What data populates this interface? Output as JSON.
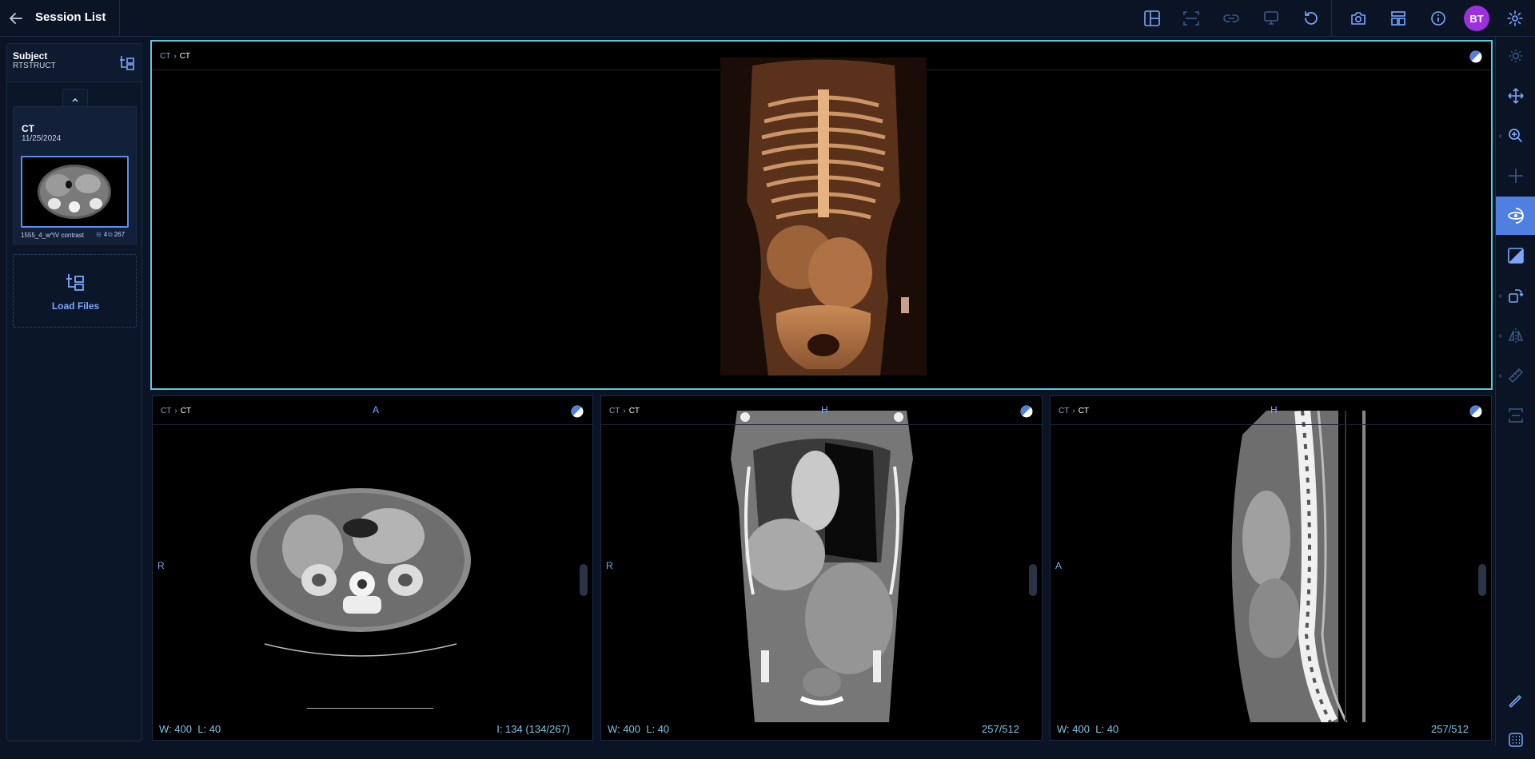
{
  "header": {
    "title": "Session List",
    "avatar_initials": "BT",
    "avatar_color": "#9b30e0",
    "toolbar_icons": [
      "layout-icon",
      "fullscreen-capture-icon",
      "link-icon",
      "presentation-icon",
      "reset-icon",
      "camera-icon",
      "panels-icon",
      "info-icon",
      "settings-icon"
    ]
  },
  "sidebar": {
    "subject_label": "Subject",
    "subject_value": "RTSTRUCT",
    "study": {
      "modality": "CT",
      "date": "11/25/2024",
      "series_description": "1555_4_w^IV contrast",
      "series_number": "4",
      "image_count": "267"
    },
    "load_files_label": "Load Files"
  },
  "viewports": [
    {
      "id": "vp-3d",
      "crumb_modality": "CT",
      "crumb_series": "CT",
      "active": true
    },
    {
      "id": "vp-axial",
      "crumb_modality": "CT",
      "crumb_series": "CT",
      "orient_top": "A",
      "orient_left": "R",
      "wl_w_label": "W:",
      "wl_w": "400",
      "wl_l_label": "L:",
      "wl_l": "40",
      "slice_info": "I: 134 (134/267)"
    },
    {
      "id": "vp-coronal",
      "crumb_modality": "CT",
      "crumb_series": "CT",
      "orient_top": "H",
      "orient_left": "R",
      "wl_w_label": "W:",
      "wl_w": "400",
      "wl_l_label": "L:",
      "wl_l": "40",
      "slice_info": "257/512"
    },
    {
      "id": "vp-sagittal",
      "crumb_modality": "CT",
      "crumb_series": "CT",
      "orient_top": "H",
      "orient_left": "A",
      "wl_w_label": "W:",
      "wl_w": "400",
      "wl_l_label": "L:",
      "wl_l": "40",
      "slice_info": "257/512"
    }
  ],
  "right_toolbar": {
    "tools": [
      "brightness-icon",
      "pan-icon",
      "zoom-icon",
      "crosshair-icon",
      "rotate-3d-icon",
      "window-level-icon",
      "rotate-icon",
      "flip-icon",
      "measure-ruler-icon",
      "segment-icon",
      "annotate-icon",
      "grid-icon"
    ],
    "active_tool": "rotate-3d-icon",
    "accent_color": "#4f7fe0"
  },
  "colors": {
    "background": "#0b1425",
    "active_viewport_border": "#5fc6d8",
    "overlay_text": "#7ec6e8",
    "orientation_marker": "#7aa6ff"
  }
}
